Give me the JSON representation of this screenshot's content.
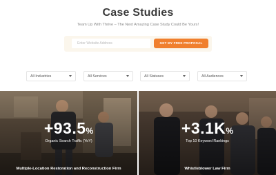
{
  "page": {
    "title": "Case Studies",
    "subtitle": "Team Up With Thrive – The Next Amazing Case Study Could Be Yours!"
  },
  "lead_form": {
    "email_placeholder": "Enter Website Address",
    "cta_label": "GET MY FREE PROPOSAL"
  },
  "filters": [
    {
      "label": "All Industries"
    },
    {
      "label": "All Services"
    },
    {
      "label": "All Statuses"
    },
    {
      "label": "All Audiences"
    }
  ],
  "cases": [
    {
      "stat_value": "+93.5",
      "stat_unit": "%",
      "caption": "Organic Search Traffic (YoY)",
      "name": "Multiple-Location Restoration and Reconstruction Firm"
    },
    {
      "stat_value": "+3.1K",
      "stat_unit": "%",
      "caption": "Top 10 Keyword Rankings",
      "name": "Whistleblower Law Firm"
    }
  ],
  "colors": {
    "accent": "#f07f2e",
    "title": "#3a3a3a",
    "form_band": "#fbf6ec"
  }
}
